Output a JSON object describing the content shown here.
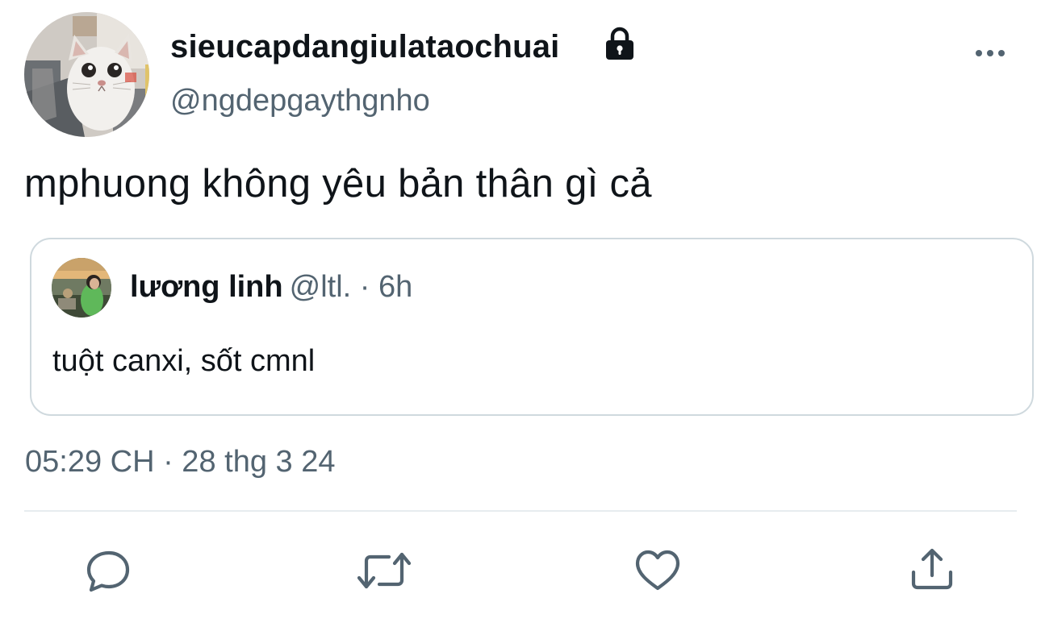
{
  "author": {
    "display_name": "sieucapdangiulataochuai",
    "handle": "@ngdepgaythgnho",
    "protected": true
  },
  "tweet": {
    "text": "mphuong không yêu bản thân gì cả",
    "timestamp": "05:29 CH · 28 thg 3 24"
  },
  "quoted_tweet": {
    "display_name": "lương linh",
    "meta": "@ltl. · 6h",
    "text": "tuột canxi, sốt cmnl"
  },
  "actions": {
    "icons": [
      "reply-icon",
      "retweet-icon",
      "like-icon",
      "share-icon"
    ]
  },
  "colors": {
    "text_primary": "#0f1419",
    "text_secondary": "#536471",
    "border": "#cfd9de",
    "icon": "#536471"
  }
}
